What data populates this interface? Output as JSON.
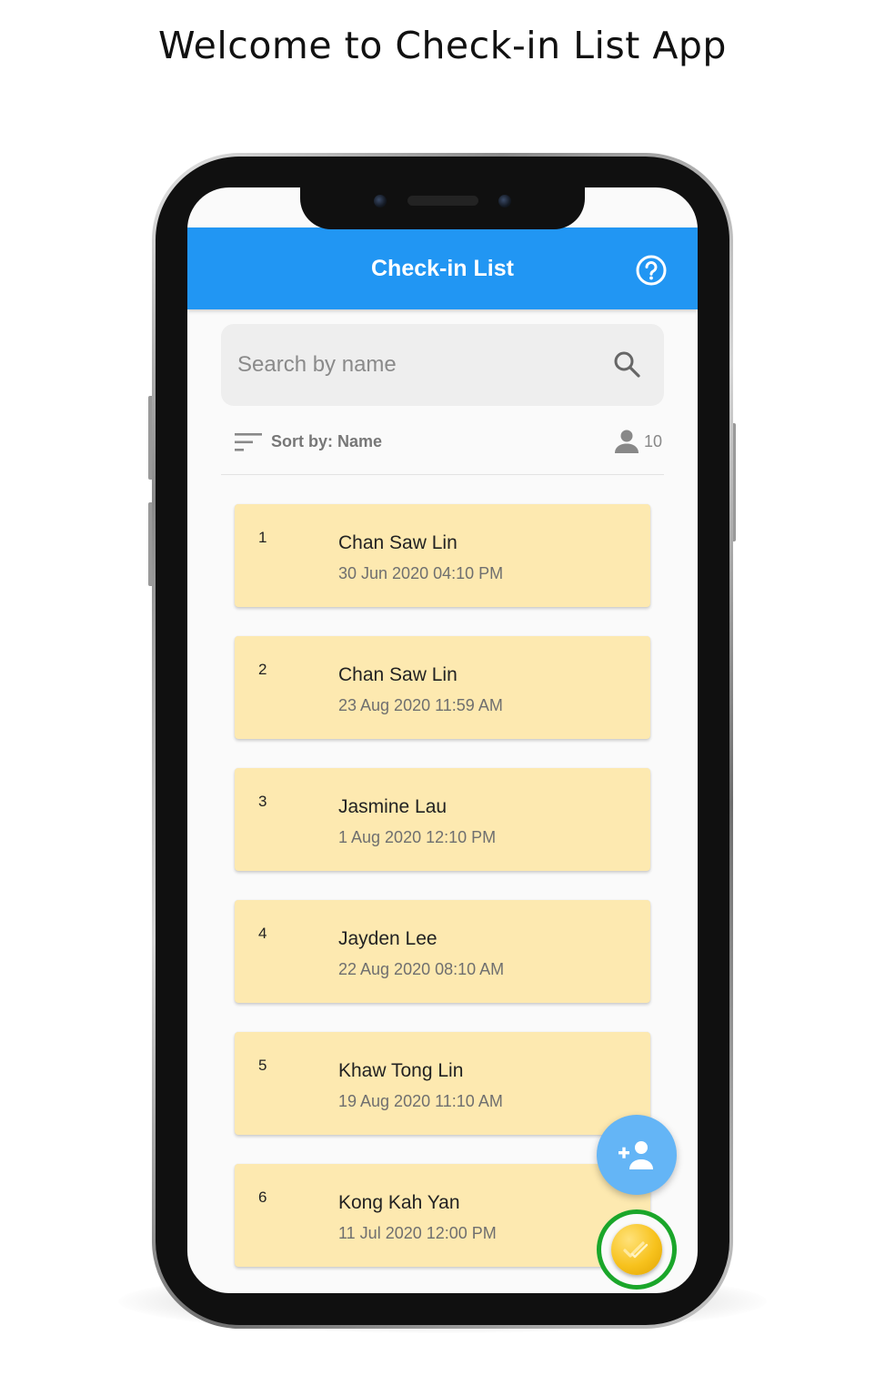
{
  "headline": "Welcome to Check-in List App",
  "appbar": {
    "title": "Check-in List",
    "help_icon": "help-circle-icon"
  },
  "search": {
    "placeholder": "Search by name",
    "value": "",
    "icon": "search-icon"
  },
  "sort": {
    "label": "Sort by: Name",
    "icon": "sort-icon"
  },
  "count": {
    "value": "10",
    "icon": "person-icon"
  },
  "checkins": [
    {
      "index": "1",
      "name": "Chan Saw Lin",
      "time": "30 Jun 2020 04:10 PM"
    },
    {
      "index": "2",
      "name": "Chan Saw Lin",
      "time": "23 Aug 2020 11:59 AM"
    },
    {
      "index": "3",
      "name": "Jasmine Lau",
      "time": "1 Aug 2020 12:10 PM"
    },
    {
      "index": "4",
      "name": "Jayden Lee",
      "time": "22 Aug 2020 08:10 AM"
    },
    {
      "index": "5",
      "name": "Khaw Tong Lin",
      "time": "19 Aug 2020 11:10 AM"
    },
    {
      "index": "6",
      "name": "Kong Kah Yan",
      "time": "11 Jul 2020 12:00 PM"
    }
  ],
  "fabs": {
    "add_icon": "add-person-icon",
    "checkin_icon": "coin-check-icon"
  },
  "colors": {
    "appbar": "#2196f3",
    "card": "#fde9b0",
    "fab_add": "#64b5f6",
    "highlight_ring": "#1aa62a"
  }
}
